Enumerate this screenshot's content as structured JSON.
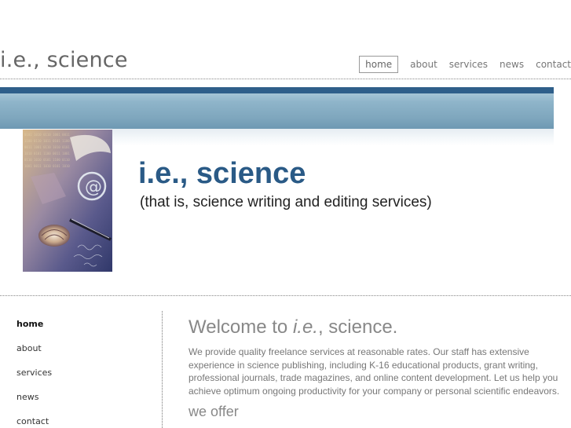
{
  "header": {
    "site_title": "i.e., science",
    "nav": [
      {
        "label": "home",
        "active": true
      },
      {
        "label": "about",
        "active": false
      },
      {
        "label": "services",
        "active": false
      },
      {
        "label": "news",
        "active": false
      },
      {
        "label": "contact",
        "active": false
      }
    ]
  },
  "hero": {
    "title": "i.e., science",
    "subtitle": "(that is, science writing and editing services)",
    "image_icon": "science-collage-image"
  },
  "sidebar": {
    "items": [
      {
        "label": "home",
        "active": true
      },
      {
        "label": "about",
        "active": false
      },
      {
        "label": "services",
        "active": false
      },
      {
        "label": "news",
        "active": false
      },
      {
        "label": "contact",
        "active": false
      }
    ]
  },
  "main": {
    "welcome_prefix": "Welcome to ",
    "welcome_emphasis": "i.e.",
    "welcome_suffix": ", science.",
    "intro": "We provide quality freelance services at reasonable rates. Our staff has extensive experience in science publishing, including K-16 educational products, grant writing, professional journals, trade magazines, and online content development. Let us help you achieve optimum ongoing productivity for your company or personal scientific endeavors.",
    "offer_heading": "we offer"
  },
  "colors": {
    "accent_dark": "#2f5f8a",
    "band_light": "#8fb5ca",
    "hero_title": "#2a5a86"
  }
}
